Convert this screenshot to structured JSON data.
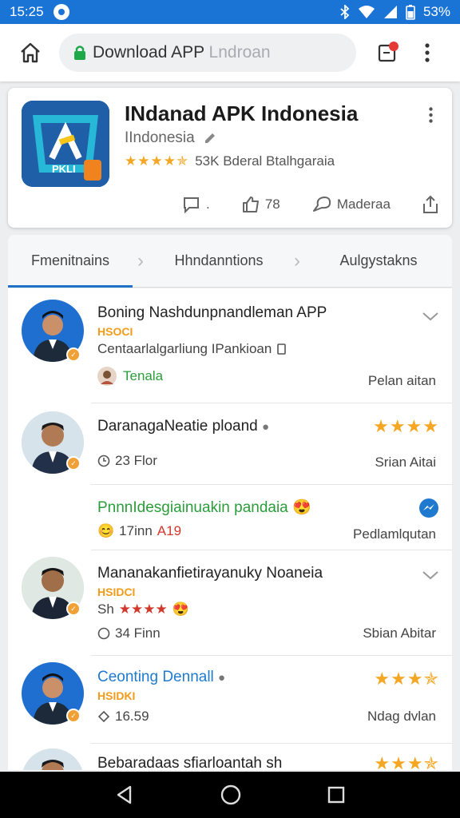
{
  "status_bar": {
    "time": "15:25",
    "battery": "53%"
  },
  "browser": {
    "url_main": "Download APP ",
    "url_faded": "Lndroan"
  },
  "app": {
    "title": "INdanad APK Indonesia",
    "subtitle": "IIndonesia",
    "rating_text": "53K Bderal Btalhgaraia",
    "stars": "★★★★✯",
    "actions": [
      {
        "label": "."
      },
      {
        "label": "78"
      },
      {
        "label": "Maderaa"
      }
    ],
    "icon_label": "PKLI"
  },
  "tabs": [
    "Fmenitnains",
    "Hhndanntions",
    "Aulgystakns"
  ],
  "list": [
    {
      "title": "Boning Nashdunpnandleman APP",
      "tag": "HSOCI",
      "line2": "Centaarlalgarliung IPankioan",
      "author": "Tenala",
      "right": "Pelan aitan"
    },
    {
      "title": "DaranagaNeatie ploand",
      "stars": "★★★★",
      "meta": "23 Flor",
      "right": "Srian Aitai"
    },
    {
      "title": "PnnnIdesgiainuakin pandaia",
      "meta": "17inn",
      "meta_red": "A19",
      "right": "Pedlamlqutan"
    },
    {
      "title": "Mananakanfietirayanuky Noaneia",
      "tag": "HSIDCI",
      "rating_prefix": "Sh",
      "stars_red": "★★★★",
      "meta": "34 Finn",
      "right": "Sbian Abitar"
    },
    {
      "title": "Ceonting Dennall",
      "tag": "HSIDKI",
      "stars": "★★★✯",
      "meta": "16.59",
      "right": "Ndag dvlan"
    },
    {
      "title": "Bebaradaas sfiarloantah sh",
      "stars": "★★★✯"
    }
  ]
}
